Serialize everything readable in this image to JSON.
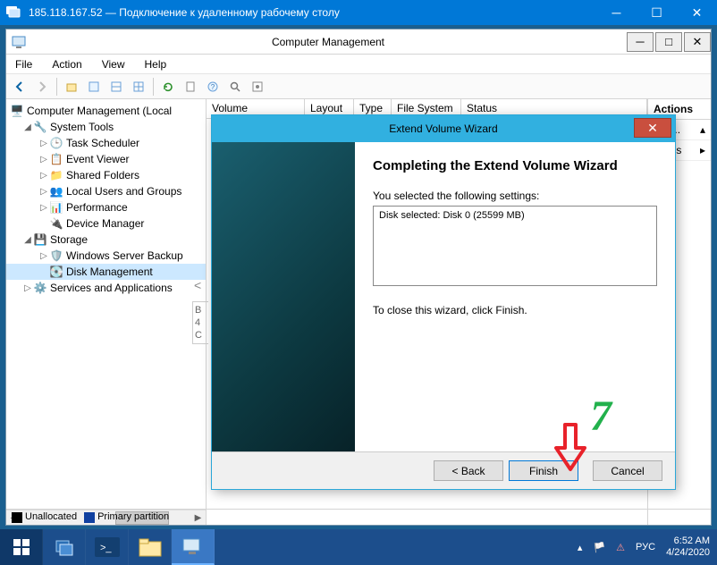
{
  "rdp": {
    "title": "185.118.167.52 — Подключение к удаленному рабочему столу"
  },
  "mmc": {
    "title": "Computer Management",
    "menu": {
      "file": "File",
      "action": "Action",
      "view": "View",
      "help": "Help"
    },
    "tree": {
      "root": "Computer Management (Local",
      "system_tools": "System Tools",
      "task_scheduler": "Task Scheduler",
      "event_viewer": "Event Viewer",
      "shared_folders": "Shared Folders",
      "local_users": "Local Users and Groups",
      "performance": "Performance",
      "device_manager": "Device Manager",
      "storage": "Storage",
      "ws_backup": "Windows Server Backup",
      "disk_mgmt": "Disk Management",
      "services_apps": "Services and Applications"
    },
    "list_headers": {
      "volume": "Volume",
      "layout": "Layout",
      "type": "Type",
      "fs": "File System",
      "status": "Status"
    },
    "legend": {
      "unalloc": "Unallocated",
      "primary": "Primary partition"
    },
    "peek": {
      "b": "B",
      "four": "4",
      "c": "C"
    },
    "actions": {
      "header": "Actions",
      "item1": "age...",
      "item2": "ctions"
    }
  },
  "wizard": {
    "title": "Extend Volume Wizard",
    "heading": "Completing the Extend Volume Wizard",
    "subtext": "You selected the following settings:",
    "setting_line": "Disk selected: Disk 0 (25599 MB)",
    "close_hint": "To close this wizard, click Finish.",
    "back": "< Back",
    "finish": "Finish",
    "cancel": "Cancel"
  },
  "annotation": {
    "step": "7"
  },
  "taskbar": {
    "lang": "РУС",
    "time": "6:52 AM",
    "date": "4/24/2020"
  }
}
